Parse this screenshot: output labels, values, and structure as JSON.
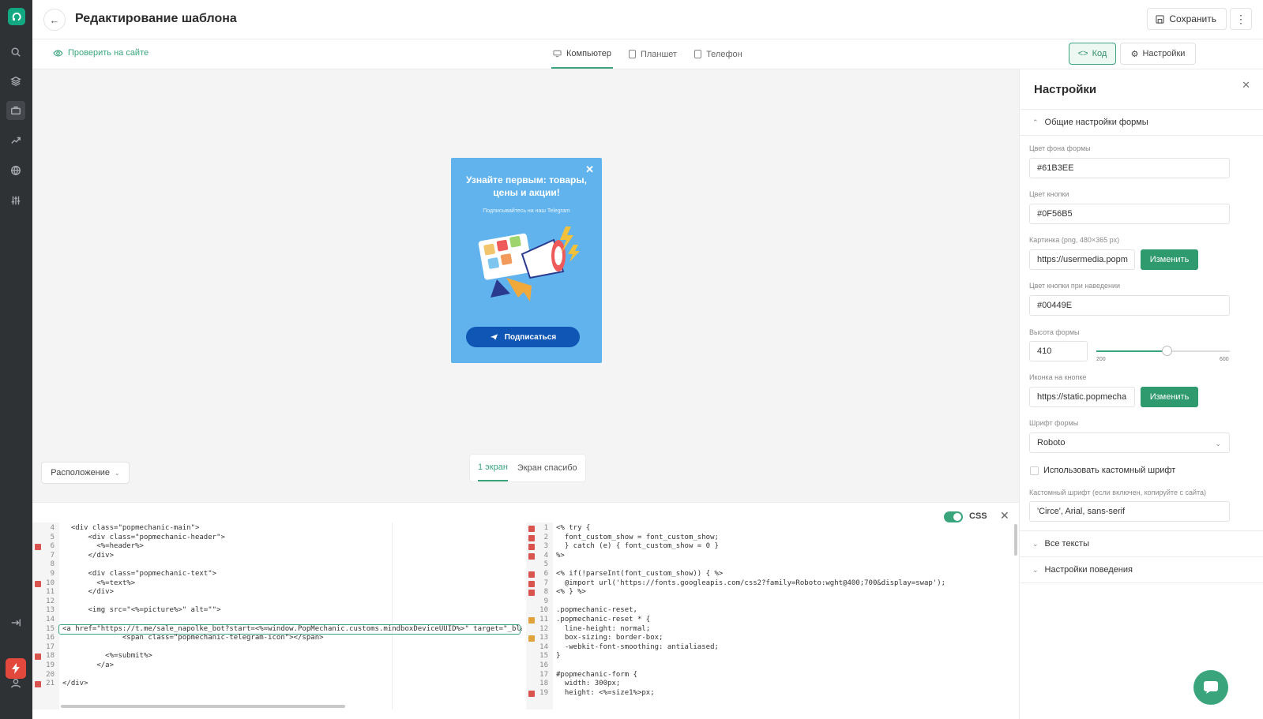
{
  "header": {
    "title": "Редактирование шаблона",
    "save_label": "Сохранить"
  },
  "toolbar": {
    "check_site": "Проверить на сайте",
    "devices": [
      "Компьютер",
      "Планшет",
      "Телефон"
    ],
    "code_label": "Код",
    "settings_label": "Настройки"
  },
  "popup": {
    "title": "Узнайте первым: товары, цены и акции!",
    "subtitle": "Подписывайтесь на наш Telegram",
    "button": "Подписаться",
    "bg_color": "#61B3EE",
    "button_color": "#0F56B5"
  },
  "canvas": {
    "arrangement": "Расположение",
    "screens": [
      "1 экран",
      "Экран спасибо"
    ]
  },
  "code_panel": {
    "css_label": "CSS",
    "html_lines": [
      {
        "n": "4",
        "t": "  <div class=\"popmechanic-main\">"
      },
      {
        "n": "5",
        "t": "      <div class=\"popmechanic-header\">"
      },
      {
        "n": "6",
        "t": "        <%=header%>"
      },
      {
        "n": "7",
        "t": "      </div>"
      },
      {
        "n": "8",
        "t": ""
      },
      {
        "n": "9",
        "t": "      <div class=\"popmechanic-text\">"
      },
      {
        "n": "10",
        "t": "        <%=text%>"
      },
      {
        "n": "11",
        "t": "      </div>"
      },
      {
        "n": "12",
        "t": ""
      },
      {
        "n": "13",
        "t": "      <img src=\"<%=picture%>\" alt=\"\">"
      },
      {
        "n": "14",
        "t": ""
      },
      {
        "n": "15",
        "t": "<a href=\"https://t.me/sale_napolke_bot?start=<%=window.PopMechanic.customs.mindboxDeviceUUID%>\" target=\"_blank\""
      },
      {
        "n": "16",
        "t": "              <span class=\"popmechanic-telegram-icon\"></span>"
      },
      {
        "n": "17",
        "t": ""
      },
      {
        "n": "18",
        "t": "          <%=submit%>"
      },
      {
        "n": "19",
        "t": "        </a>"
      },
      {
        "n": "20",
        "t": ""
      },
      {
        "n": "21",
        "t": "</div>"
      }
    ],
    "css_lines": [
      {
        "n": "1",
        "t": "<% try {"
      },
      {
        "n": "2",
        "t": "  font_custom_show = font_custom_show;"
      },
      {
        "n": "3",
        "t": "  } catch (e) { font_custom_show = 0 }"
      },
      {
        "n": "4",
        "t": "%>"
      },
      {
        "n": "5",
        "t": ""
      },
      {
        "n": "6",
        "t": "<% if(!parseInt(font_custom_show)) { %>"
      },
      {
        "n": "7",
        "t": "  @import url('https://fonts.googleapis.com/css2?family=Roboto:wght@400;700&display=swap');"
      },
      {
        "n": "8",
        "t": "<% } %>"
      },
      {
        "n": "9",
        "t": ""
      },
      {
        "n": "10",
        "t": ".popmechanic-reset,"
      },
      {
        "n": "11",
        "t": ".popmechanic-reset * {"
      },
      {
        "n": "12",
        "t": "  line-height: normal;"
      },
      {
        "n": "13",
        "t": "  box-sizing: border-box;"
      },
      {
        "n": "14",
        "t": "  -webkit-font-smoothing: antialiased;"
      },
      {
        "n": "15",
        "t": "}"
      },
      {
        "n": "16",
        "t": ""
      },
      {
        "n": "17",
        "t": "#popmechanic-form {"
      },
      {
        "n": "18",
        "t": "  width: 300px;"
      },
      {
        "n": "19",
        "t": "  height: <%=size1%>px;"
      }
    ]
  },
  "settings": {
    "title": "Настройки",
    "section_general": "Общие настройки формы",
    "bg_color_label": "Цвет фона формы",
    "bg_color_value": "#61B3EE",
    "button_color_label": "Цвет кнопки",
    "button_color_value": "#0F56B5",
    "picture_label": "Картинка (png, 480×365 px)",
    "picture_value": "https://usermedia.popm",
    "change_label": "Изменить",
    "hover_color_label": "Цвет кнопки при наведении",
    "hover_color_value": "#00449E",
    "height_label": "Высота формы",
    "height_value": "410",
    "height_min": "200",
    "height_max": "600",
    "height_fraction": 0.525,
    "icon_label": "Иконка на кнопке",
    "icon_value": "https://static.popmecha",
    "font_label": "Шрифт формы",
    "font_value": "Roboto",
    "custom_font_checkbox": "Использовать кастомный шрифт",
    "custom_font_label": "Кастомный шрифт (если включен, копируйте с сайта)",
    "custom_font_value": "'Circe', Arial, sans-serif",
    "section_texts": "Все тексты",
    "section_behavior": "Настройки поведения"
  }
}
